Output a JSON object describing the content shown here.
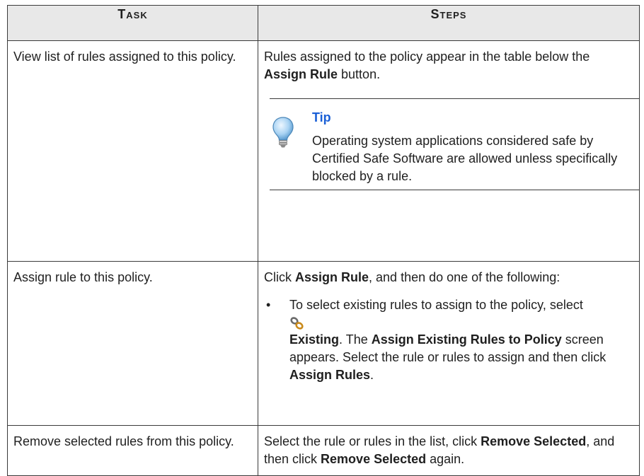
{
  "table": {
    "header": {
      "task": "Task",
      "steps": "Steps"
    },
    "rows": [
      {
        "task": "View list of rules assigned to this policy.",
        "steps": {
          "t1": "Rules assigned to the policy appear in the table below the ",
          "b1": "Assign Rule",
          "t2": " button.",
          "tip": {
            "title": "Tip",
            "text": "Operating system applications considered safe by Certified Safe Software are allowed unless specifically blocked by a rule.",
            "icon": "lightbulb-icon"
          }
        }
      },
      {
        "task": "Assign rule to this policy.",
        "steps": {
          "t1": "Click ",
          "b1": "Assign Rule",
          "t2": ", and then do one of the following:",
          "bullet": {
            "mark": "•",
            "t1": "To select existing rules to assign to the policy, select",
            "icon": "link-icon",
            "b1": "Existing",
            "t2": ". The ",
            "b2": "Assign Existing Rules to Policy",
            "t3": " screen appears. Select the rule or rules to assign and then click ",
            "b3": "Assign Rules",
            "t4": "."
          }
        }
      },
      {
        "task": "Remove selected rules from this policy.",
        "steps": {
          "t1": "Select the rule or rules in the list, click ",
          "b1": "Remove Selected",
          "t2": ", and then click ",
          "b2": "Remove Selected",
          "t3": " again."
        }
      }
    ]
  }
}
